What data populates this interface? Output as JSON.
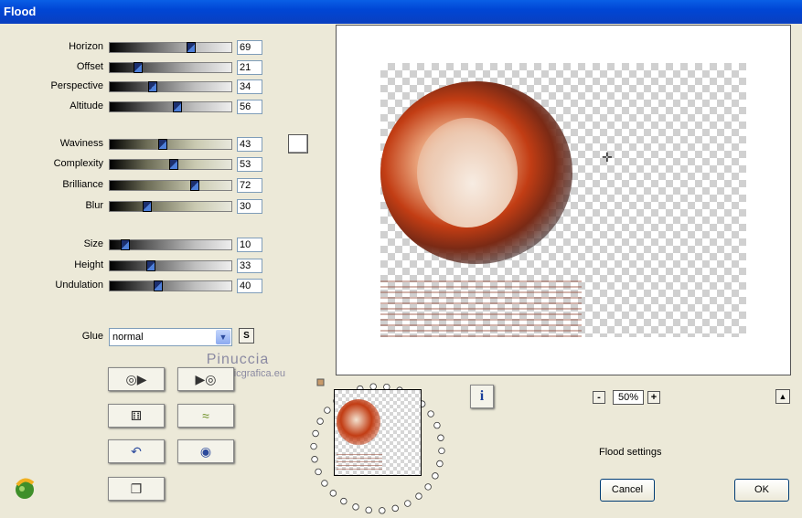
{
  "window": {
    "title": "Flood"
  },
  "sliders_group1": [
    {
      "label": "Horizon",
      "value": "69",
      "fraction": 0.69
    },
    {
      "label": "Offset",
      "value": "21",
      "fraction": 0.21
    },
    {
      "label": "Perspective",
      "value": "34",
      "fraction": 0.34
    },
    {
      "label": "Altitude",
      "value": "56",
      "fraction": 0.56
    }
  ],
  "sliders_group2": [
    {
      "label": "Waviness",
      "value": "43",
      "fraction": 0.43
    },
    {
      "label": "Complexity",
      "value": "53",
      "fraction": 0.53
    },
    {
      "label": "Brilliance",
      "value": "72",
      "fraction": 0.72
    },
    {
      "label": "Blur",
      "value": "30",
      "fraction": 0.3
    }
  ],
  "sliders_group3": [
    {
      "label": "Size",
      "value": "10",
      "fraction": 0.1
    },
    {
      "label": "Height",
      "value": "33",
      "fraction": 0.33
    },
    {
      "label": "Undulation",
      "value": "40",
      "fraction": 0.4
    }
  ],
  "glue": {
    "label": "Glue",
    "value": "normal",
    "s_button": "S"
  },
  "watermark": {
    "name": "Pinuccia",
    "site": "www.magicgrafica.eu"
  },
  "preview": {
    "zoom": "50%",
    "zoom_minus": "-",
    "zoom_plus": "+",
    "info_label": "i"
  },
  "status_text": "Flood settings",
  "buttons": {
    "cancel": "Cancel",
    "ok": "OK"
  },
  "colors": {
    "titlebar": "#0a5fe6",
    "dialog_bg": "#ece9d8"
  }
}
